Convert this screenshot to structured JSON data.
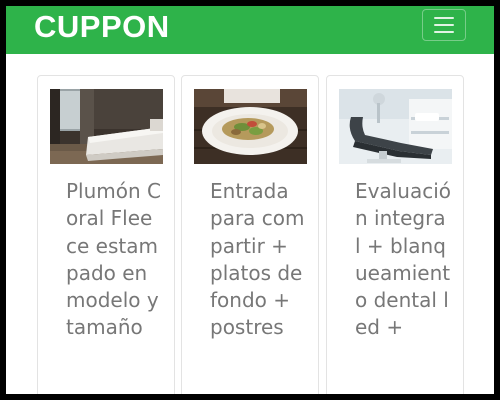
{
  "header": {
    "brand": "CUPPON",
    "brand_color": "#2eb34a",
    "menu_icon": "hamburger-menu-icon"
  },
  "cards": [
    {
      "title": "Plumón Coral Fleece estampado en modelo y tamaño",
      "image": "bedroom-bed-photo"
    },
    {
      "title": "Entrada para compartir + platos de fondo + postres",
      "image": "plated-food-dish-photo"
    },
    {
      "title": "Evaluación integral + blanqueamiento dental led +",
      "image": "dental-chair-photo"
    }
  ]
}
